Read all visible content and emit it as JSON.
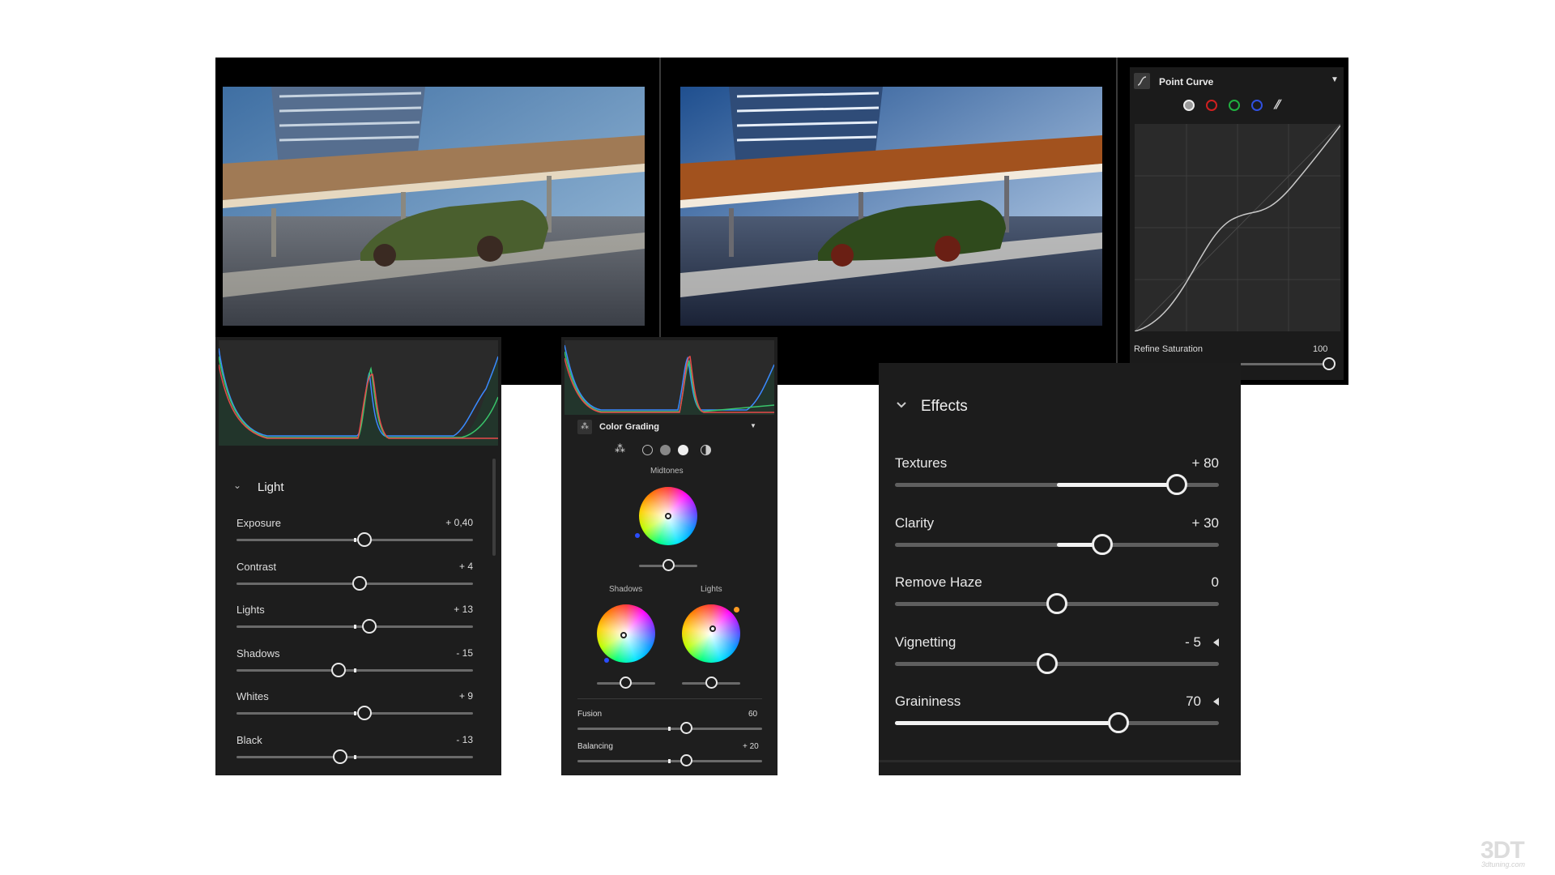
{
  "point_curve": {
    "title": "Point Curve",
    "channels": [
      "white",
      "red",
      "green",
      "blue"
    ],
    "refine_label": "Refine Saturation",
    "refine_value": "100",
    "refine_level": 1.0
  },
  "light": {
    "header": "Light",
    "rows": [
      {
        "label": "Exposure",
        "value": "+ 0,40",
        "level": 0.54
      },
      {
        "label": "Contrast",
        "value": "+ 4",
        "level": 0.52
      },
      {
        "label": "Lights",
        "value": "+ 13",
        "level": 0.56
      },
      {
        "label": "Shadows",
        "value": "- 15",
        "level": 0.43
      },
      {
        "label": "Whites",
        "value": "+ 9",
        "level": 0.54
      },
      {
        "label": "Black",
        "value": "- 13",
        "level": 0.44
      }
    ]
  },
  "color_grading": {
    "title": "Color Grading",
    "midtones_label": "Midtones",
    "shadows_label": "Shadows",
    "lights_label": "Lights",
    "fusion_label": "Fusion",
    "fusion_value": "60",
    "fusion_level": 0.59,
    "balancing_label": "Balancing",
    "balancing_value": "+ 20",
    "balancing_level": 0.59
  },
  "effects": {
    "header": "Effects",
    "rows": [
      {
        "label": "Textures",
        "value": "+ 80",
        "level": 0.87,
        "fill": "center"
      },
      {
        "label": "Clarity",
        "value": "+ 30",
        "level": 0.64,
        "fill": "center"
      },
      {
        "label": "Remove Haze",
        "value": "0",
        "level": 0.5,
        "fill": "none"
      },
      {
        "label": "Vignetting",
        "value": "- 5",
        "level": 0.47,
        "fill": "none",
        "arrow": true
      },
      {
        "label": "Graininess",
        "value": "70",
        "level": 0.69,
        "fill": "left",
        "arrow": true
      }
    ]
  },
  "watermark": {
    "logo": "3DT",
    "site": "3dtuning.com"
  },
  "colors": {
    "panel_bg": "#1c1c1c",
    "track": "#5f5f5f",
    "knob": "#eeeeee"
  }
}
